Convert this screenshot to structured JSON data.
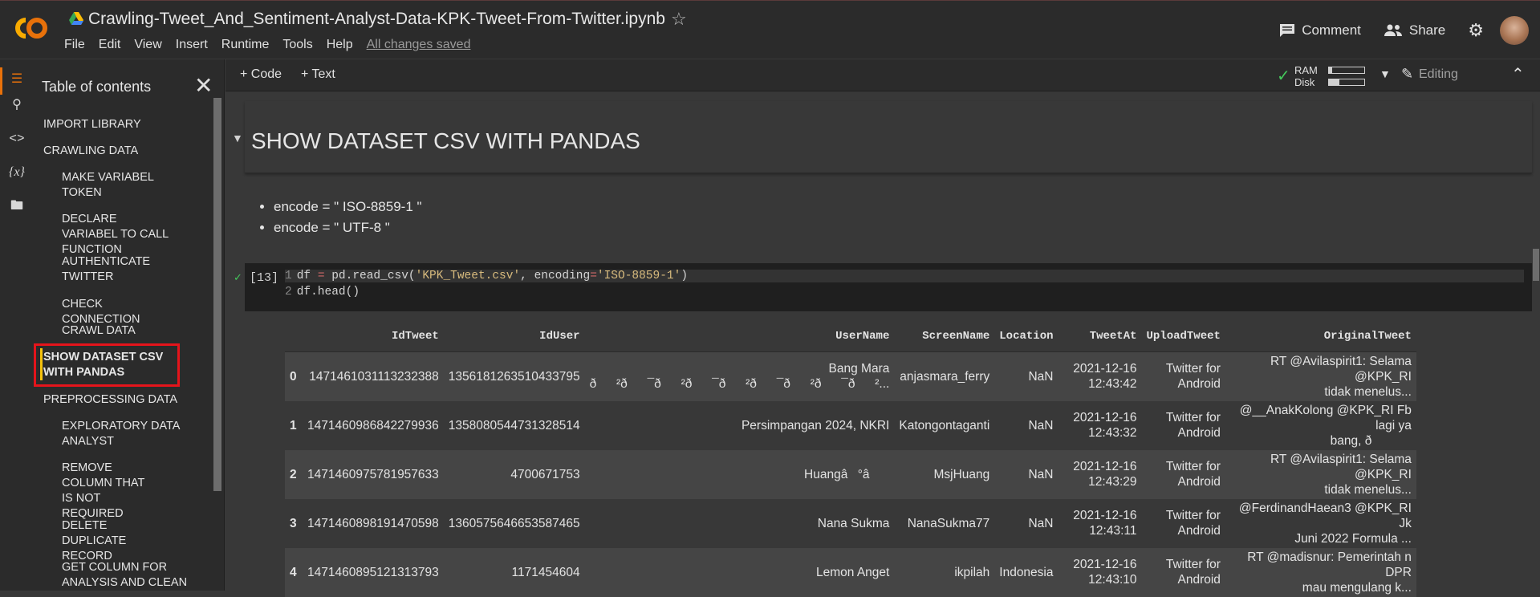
{
  "header": {
    "title": "Crawling-Tweet_And_Sentiment-Analyst-Data-KPK-Tweet-From-Twitter.ipynb",
    "menu": [
      "File",
      "Edit",
      "View",
      "Insert",
      "Runtime",
      "Tools",
      "Help"
    ],
    "saved": "All changes saved",
    "comment_label": "Comment",
    "share_label": "Share"
  },
  "toolbar": {
    "code_label": "+ Code",
    "text_label": "+ Text",
    "ram_label": "RAM",
    "disk_label": "Disk",
    "ram_fill": 0.1,
    "disk_fill": 0.3,
    "editing_label": "Editing"
  },
  "toc": {
    "title": "Table of contents",
    "items": [
      {
        "label": "IMPORT LIBRARY",
        "level": 1
      },
      {
        "label": "CRAWLING DATA",
        "level": 1
      },
      {
        "label": "MAKE VARIABEL TOKEN",
        "level": 2
      },
      {
        "label": "DECLARE VARIABEL TO CALL FUNCTION",
        "level": 2
      },
      {
        "label": "AUTHENTICATE TWITTER",
        "level": 2
      },
      {
        "label": "CHECK CONNECTION",
        "level": 2
      },
      {
        "label": "CRAWL DATA",
        "level": 2
      },
      {
        "label": "SHOW DATASET CSV WITH PANDAS",
        "level": 1,
        "selected": true
      },
      {
        "label": "PREPROCESSING DATA",
        "level": 1
      },
      {
        "label": "EXPLORATORY DATA ANALYST",
        "level": 2
      },
      {
        "label": "REMOVE COLUMN THAT IS NOT REQUIRED",
        "level": 2
      },
      {
        "label": "DELETE DUPLICATE RECORD",
        "level": 2
      },
      {
        "label": "GET COLUMN FOR ANALYSIS AND CLEAN",
        "level": 2
      }
    ]
  },
  "notebook": {
    "section_title": "SHOW DATASET CSV WITH PANDAS",
    "bullets": [
      "encode = \" ISO-8859-1 \"",
      "encode = \" UTF-8 \""
    ],
    "exec_count": "[13]",
    "code_line1_a": "df ",
    "code_line1_op": "=",
    "code_line1_b": " pd.read_csv(",
    "code_line1_str1": "'KPK_Tweet.csv'",
    "code_line1_c": ", encoding",
    "code_line1_str2": "'ISO-8859-1'",
    "code_line1_d": ")",
    "code_line2": "df.head()"
  },
  "table": {
    "columns": [
      "",
      "IdTweet",
      "IdUser",
      "UserName",
      "ScreenName",
      "Location",
      "TweetAt",
      "UploadTweet",
      "OriginalTweet"
    ],
    "rows": [
      [
        "0",
        "1471461031113232388",
        "1356181263510433795",
        "Bang Mara\nð²ð¯ð²ð¯ð²ð¯ð²ð¯ð²...",
        "anjasmara_ferry",
        "NaN",
        "2021-12-16\n12:43:42",
        "Twitter for\nAndroid",
        "RT @Avilaspirit1: Selama @KPK_RI\ntidak menelus..."
      ],
      [
        "1",
        "1471460986842279936",
        "1358080544731328514",
        "Persimpangan 2024, NKRI",
        "Katongontaganti",
        "NaN",
        "2021-12-16\n12:43:32",
        "Twitter for\nAndroid",
        "@__AnakKolong @KPK_RI Fb lagi ya\nbang, ð"
      ],
      [
        "2",
        "1471460975781957633",
        "4700671753",
        "Huangâ°â",
        "MsjHuang",
        "NaN",
        "2021-12-16\n12:43:29",
        "Twitter for\nAndroid",
        "RT @Avilaspirit1: Selama @KPK_RI\ntidak menelus..."
      ],
      [
        "3",
        "1471460898191470598",
        "1360575646653587465",
        "Nana Sukma",
        "NanaSukma77",
        "NaN",
        "2021-12-16\n12:43:11",
        "Twitter for\nAndroid",
        "@FerdinandHaean3 @KPK_RI Jk\nJuni 2022 Formula ..."
      ],
      [
        "4",
        "1471460895121313793",
        "1171454604",
        "Lemon Anget",
        "ikpilah",
        "Indonesia",
        "2021-12-16\n12:43:10",
        "Twitter for\nAndroid",
        "RT @madisnur: Pemerintah n DPR\nmau mengulang k..."
      ]
    ]
  }
}
